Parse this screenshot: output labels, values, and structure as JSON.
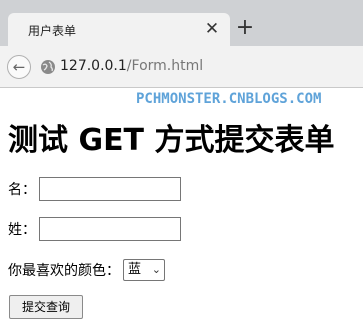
{
  "browser": {
    "tab_title": "用户表单",
    "close_glyph": "✕",
    "new_tab_glyph": "+",
    "back_glyph": "←",
    "url_host": "127.0.0.1",
    "url_path": "/Form.html"
  },
  "page": {
    "watermark": "PCHMONSTER.CNBLOGS.COM",
    "title": "测试 GET 方式提交表单",
    "form": {
      "name_label": "名：",
      "name_value": "",
      "surname_label": "姓：",
      "surname_value": "",
      "color_label": "你最喜欢的颜色：",
      "color_selected": "蓝",
      "submit_label": "提交查询"
    }
  },
  "colors": {
    "watermark": "#5fa3d9",
    "tabstrip": "#cfd1d4",
    "toolbar": "#f2f2f2"
  },
  "icons": {
    "back": "arrow-left-icon",
    "site": "globe-icon",
    "close": "close-icon",
    "new_tab": "plus-icon",
    "select": "chevron-down-icon"
  }
}
